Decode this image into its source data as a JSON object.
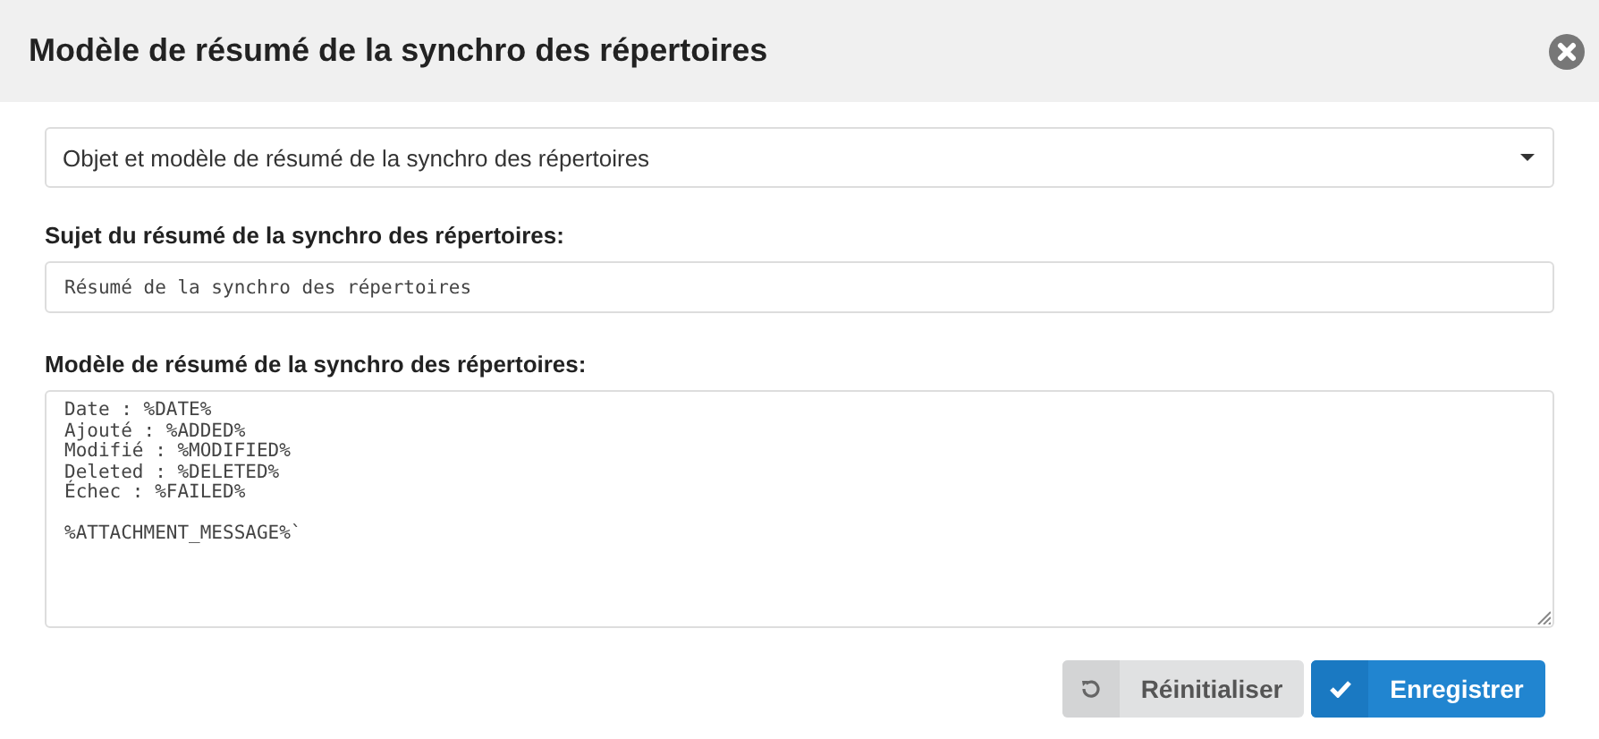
{
  "dialog": {
    "title": "Modèle de résumé de la synchro des répertoires"
  },
  "template_select": {
    "value": "Objet et modèle de résumé de la synchro des répertoires"
  },
  "subject": {
    "label": "Sujet du résumé de la synchro des répertoires:",
    "value": "Résumé de la synchro des répertoires"
  },
  "body": {
    "label": "Modèle de résumé de la synchro des répertoires:",
    "value": "Date : %DATE%\nAjouté : %ADDED%\nModifié : %MODIFIED%\nDeleted : %DELETED%\nÉchec : %FAILED%\n\n%ATTACHMENT_MESSAGE%`"
  },
  "buttons": [
    {
      "kind": "reset",
      "label": "Réinitialiser"
    },
    {
      "kind": "save",
      "label": "Enregistrer"
    }
  ]
}
